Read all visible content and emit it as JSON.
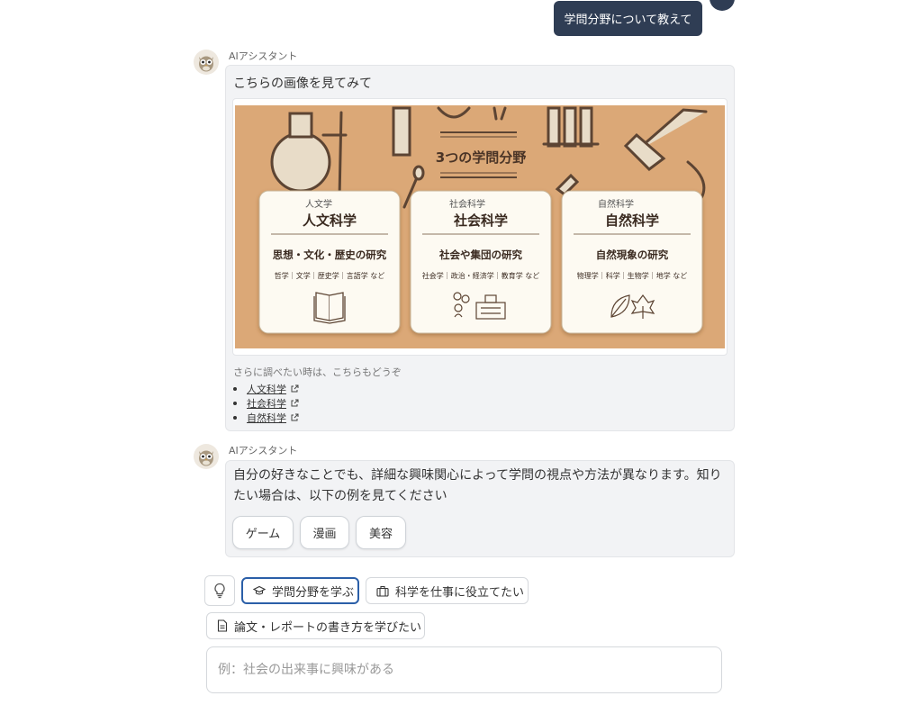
{
  "user_message": "学問分野について教えて",
  "assistant_name": "AIアシスタント",
  "message1": {
    "text": "こちらの画像を見てみて",
    "figure": {
      "heading": "3つの学問分野",
      "cards": [
        {
          "small": "人文学",
          "title": "人文科学",
          "subtitle": "思想・文化・歴史の研究",
          "examples": "哲学｜文学｜歴史学｜言語学 など",
          "icon": "book-icon"
        },
        {
          "small": "社会科学",
          "title": "社会科学",
          "subtitle": "社会や集団の研究",
          "examples": "社会学｜政治・経済学｜教育学 など",
          "icon": "people-building-icon"
        },
        {
          "small": "自然科学",
          "title": "自然科学",
          "subtitle": "自然現象の研究",
          "examples": "物理学｜科学｜生物学｜地学 など",
          "icon": "leaf-icon"
        }
      ]
    },
    "more_note": "さらに調べたい時は、こちらもどうぞ",
    "links": [
      "人文科学",
      "社会科学",
      "自然科学"
    ]
  },
  "message2": {
    "text": "自分の好きなことでも、詳細な興味関心によって学問の視点や方法が異なります。知りたい場合は、以下の例を見てください",
    "options": [
      "ゲーム",
      "漫画",
      "美容"
    ]
  },
  "suggestions": [
    {
      "label": "学問分野を学ぶ",
      "icon": "graduation-cap-icon"
    },
    {
      "label": "科学を仕事に役立てたい",
      "icon": "briefcase-icon"
    },
    {
      "label": "論文・レポートの書き方を学びたい",
      "icon": "document-icon"
    }
  ],
  "input": {
    "placeholder": "例：社会の出来事に興味がある"
  },
  "colors": {
    "user_bubble": "#2f3d54",
    "figure_bg": "#dba877",
    "selected_border": "#2b5fa8"
  }
}
